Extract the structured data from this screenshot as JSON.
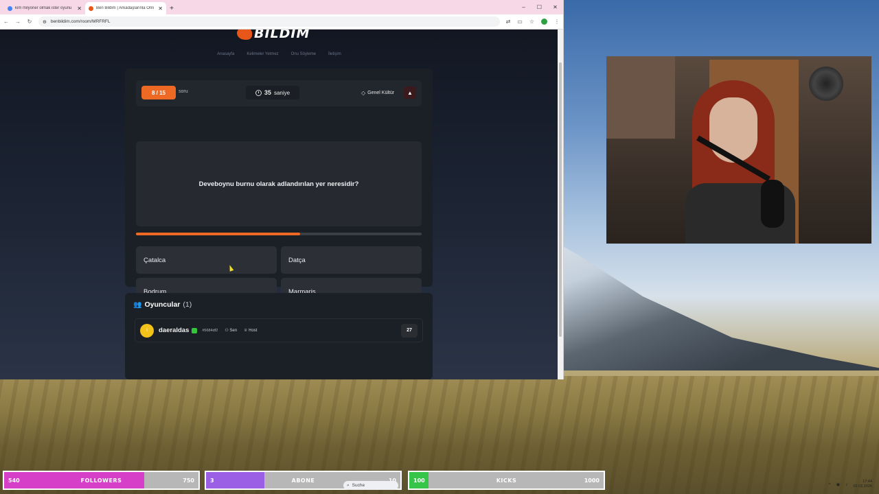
{
  "browser": {
    "tabs": [
      {
        "title": "kim milyoner olmak ister oyunu",
        "active": false
      },
      {
        "title": "Ben Bildim | Arkadaşlarınla Onli",
        "active": true
      }
    ],
    "new_tab": "+",
    "url": "benbildim.com/room/MRFRFL",
    "window_controls": {
      "minimize": "–",
      "maximize": "☐",
      "close": "✕"
    }
  },
  "site": {
    "logo_text": "BILDIM",
    "nav": [
      "Anasayfa",
      "Kelimeler Yetmez",
      "Onu Söyleme",
      "İletişim"
    ]
  },
  "game": {
    "question_counter": "8 / 15",
    "question_counter_label": "soru",
    "timer_value": "35",
    "timer_unit": "saniye",
    "category": "Genel Kültür",
    "question": "Deveboynu burnu olarak adlandırılan yer neresidir?",
    "time_progress": 0.575,
    "options": [
      "Çatalca",
      "Datça",
      "Bodrum",
      "Marmaris"
    ]
  },
  "players": {
    "title": "Oyuncular",
    "count": "(1)",
    "list": [
      {
        "avatar": "i",
        "name": "daeraldas",
        "id": "#5684df2",
        "tag_you": "Sen",
        "tag_host": "Host",
        "score": "27"
      }
    ]
  },
  "goals": [
    {
      "current": "540",
      "label": "FOLLOWERS",
      "target": "750",
      "progress": 0.72,
      "color": "#d63fc8"
    },
    {
      "current": "3",
      "label": "ABONE",
      "target": "10",
      "progress": 0.3,
      "color": "#9b5fe6"
    },
    {
      "current": "100",
      "label": "KICKS",
      "target": "1000",
      "progress": 0.1,
      "color": "#36c548"
    }
  ],
  "taskbar": {
    "search_placeholder": "Suche",
    "time": "17:44",
    "date": "02.03.2026"
  },
  "colors": {
    "accent": "#ee6a24",
    "card": "#1b1f26",
    "option": "#2c3036"
  }
}
